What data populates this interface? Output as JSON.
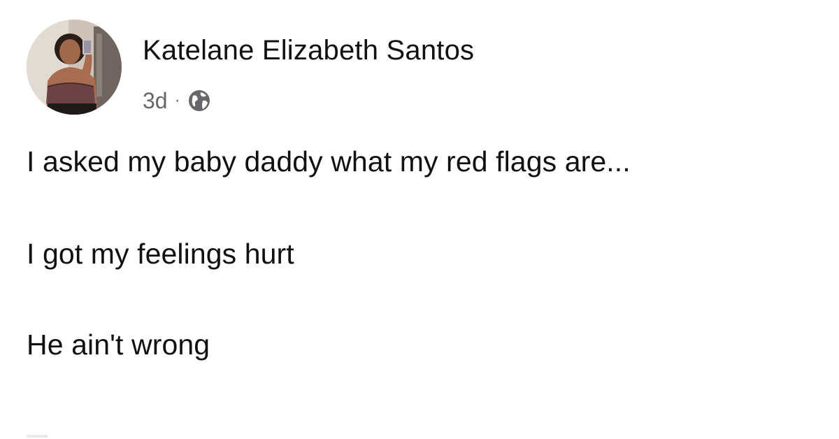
{
  "post": {
    "author": {
      "name": "Katelane Elizabeth Santos",
      "avatar_icon": "profile-photo"
    },
    "meta": {
      "timestamp": "3d",
      "separator": "·",
      "privacy_icon": "globe-icon"
    },
    "lines": [
      "I asked my baby daddy what my red flags are...",
      "I got my feelings hurt",
      "He ain't wrong"
    ]
  },
  "colors": {
    "text": "#111111",
    "meta": "#65676b",
    "background": "#ffffff"
  }
}
